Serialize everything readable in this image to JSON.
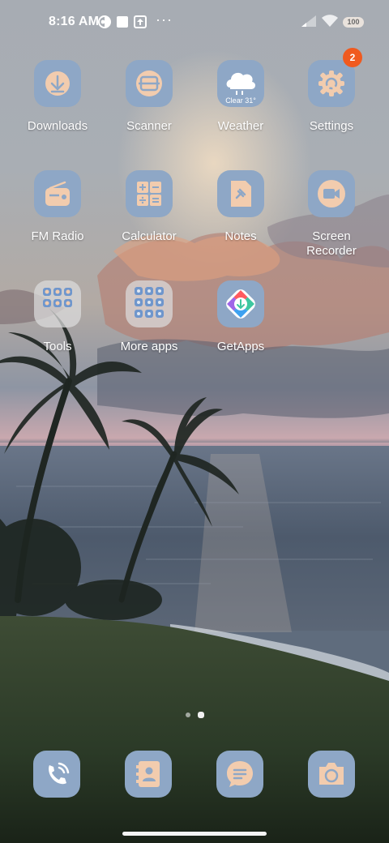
{
  "status_bar": {
    "time": "8:16 AM",
    "icons": [
      "brightness-icon",
      "square-notification-icon",
      "upload-icon",
      "more-dots-icon",
      "signal-icon",
      "wifi-icon"
    ],
    "overflow": "···",
    "battery": "100"
  },
  "colors": {
    "icon_bg": "#8ea7c6",
    "icon_fg": "#f2ccae",
    "badge": "#f05a1f"
  },
  "apps": [
    {
      "label": "Downloads",
      "icon": "download-icon"
    },
    {
      "label": "Scanner",
      "icon": "scanner-icon"
    },
    {
      "label": "Weather",
      "icon": "cloud-icon",
      "sub": "Clear 31°"
    },
    {
      "label": "Settings",
      "icon": "gear-icon",
      "badge": "2"
    },
    {
      "label": "FM Radio",
      "icon": "radio-icon"
    },
    {
      "label": "Calculator",
      "icon": "calculator-icon"
    },
    {
      "label": "Notes",
      "icon": "pin-note-icon"
    },
    {
      "label": "Screen Recorder",
      "icon": "camera-icon"
    },
    {
      "label": "Tools",
      "icon": "tools-folder-icon"
    },
    {
      "label": "More apps",
      "icon": "apps-folder-icon"
    },
    {
      "label": "GetApps",
      "icon": "getapps-icon"
    }
  ],
  "pager": {
    "pages": 2,
    "current": 2
  },
  "dock": [
    {
      "name": "phone",
      "icon": "phone-icon"
    },
    {
      "name": "contacts",
      "icon": "contacts-icon"
    },
    {
      "name": "messages",
      "icon": "message-icon"
    },
    {
      "name": "camera",
      "icon": "camera-icon"
    }
  ]
}
